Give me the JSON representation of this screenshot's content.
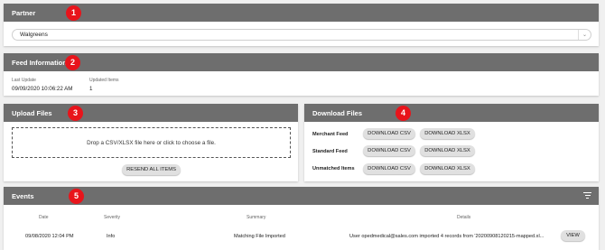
{
  "partner": {
    "title": "Partner",
    "badge": "1",
    "selected": "Walgreens",
    "caret": "⌄"
  },
  "feed_info": {
    "title": "Feed Information",
    "badge": "2",
    "last_update_label": "Last Update",
    "last_update_value": "09/09/2020 10:06:22 AM",
    "updated_items_label": "Updated Items",
    "updated_items_value": "1"
  },
  "upload": {
    "title": "Upload Files",
    "badge": "3",
    "dropzone_text": "Drop a CSV/XLSX file here or click to choose a file.",
    "resend_label": "RESEND ALL ITEMS"
  },
  "download": {
    "title": "Download Files",
    "badge": "4",
    "rows": [
      {
        "label": "Merchant Feed",
        "csv": "DOWNLOAD CSV",
        "xlsx": "DOWNLOAD XLSX"
      },
      {
        "label": "Standard Feed",
        "csv": "DOWNLOAD CSV",
        "xlsx": "DOWNLOAD XLSX"
      },
      {
        "label": "Unmatched Items",
        "csv": "DOWNLOAD CSV",
        "xlsx": "DOWNLOAD XLSX"
      }
    ]
  },
  "events": {
    "title": "Events",
    "badge": "5",
    "columns": [
      "Date",
      "Severity",
      "Summary",
      "Details"
    ],
    "rows": [
      {
        "date": "09/08/2020 12:04 PM",
        "severity": "Info",
        "summary": "Matching File Imported",
        "details": "User opedmedical@sales.com imported 4 records from '20200908120215-mapped.xl...",
        "action": "VIEW"
      }
    ]
  },
  "colors": {
    "header": "#6e6e6e",
    "badge": "#e8141b",
    "button": "#e0e0e0"
  }
}
